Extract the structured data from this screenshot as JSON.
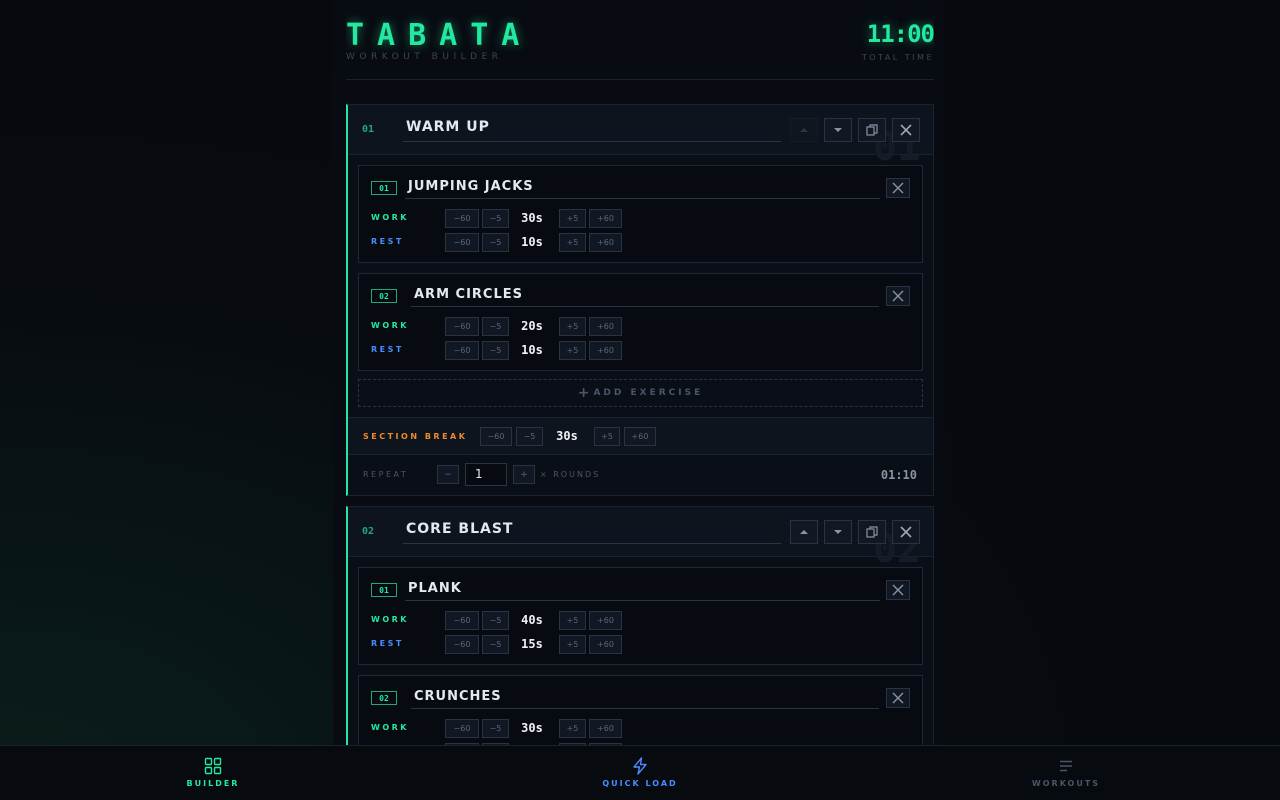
{
  "app": {
    "logo": "TABATA",
    "subtitle": "WORKOUT BUILDER",
    "total_time": "11:00",
    "total_time_label": "TOTAL TIME"
  },
  "sections": [
    {
      "number": "01",
      "title": "WARM UP",
      "watermark": "01",
      "exercises": [
        {
          "number": "01",
          "name": "JUMPING JACKS",
          "work": "30s",
          "rest": "10s"
        },
        {
          "number": "02",
          "name": "ARM CIRCLES",
          "work": "20s",
          "rest": "10s"
        }
      ],
      "add_exercise_label": "ADD EXERCISE",
      "section_break_label": "SECTION BREAK",
      "section_break": "30s",
      "repeat_label": "REPEAT",
      "repeat_value": "1",
      "rounds_label": "× ROUNDS",
      "section_total": "01:10"
    },
    {
      "number": "02",
      "title": "CORE BLAST",
      "watermark": "02",
      "exercises": [
        {
          "number": "01",
          "name": "PLANK",
          "work": "40s",
          "rest": "15s"
        },
        {
          "number": "02",
          "name": "CRUNCHES",
          "work": "30s",
          "rest": ""
        }
      ]
    }
  ],
  "labels": {
    "work": "WORK",
    "rest": "REST",
    "minus60": "−60",
    "minus5": "−5",
    "plus5": "+5",
    "plus60": "+60",
    "rep_minus": "−",
    "rep_plus": "+"
  },
  "nav": [
    {
      "label": "BUILDER",
      "icon": "grid-icon",
      "color": "#22e8a0"
    },
    {
      "label": "QUICK LOAD",
      "icon": "lightning-icon",
      "color": "#4a8cff"
    },
    {
      "label": "WORKOUTS",
      "icon": "list-icon",
      "color": "#4a5568"
    }
  ],
  "colors": {
    "accent": "#22e8a0",
    "rest": "#4a8cff",
    "break": "#f08a2a",
    "background": "#06090d"
  }
}
